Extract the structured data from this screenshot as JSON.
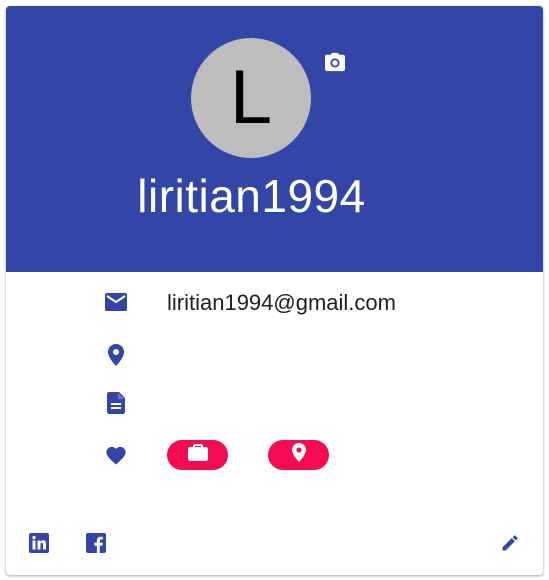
{
  "profile": {
    "avatar_letter": "L",
    "username": "liritian1994",
    "email": "liritian1994@gmail.com"
  },
  "icons": {
    "camera": "camera-icon",
    "email": "email-icon",
    "location": "location-pin-icon",
    "document": "document-icon",
    "interests": "heart-icon",
    "job_chip": "briefcase-icon",
    "location_chip": "location-pin-icon",
    "linkedin": "linkedin-icon",
    "facebook": "facebook-icon",
    "edit": "pencil-icon"
  },
  "colors": {
    "header_bg": "#3346a8",
    "avatar_bg": "#bdbdbd",
    "icon_blue": "#3346a8",
    "chip_pink": "#f50b52"
  }
}
